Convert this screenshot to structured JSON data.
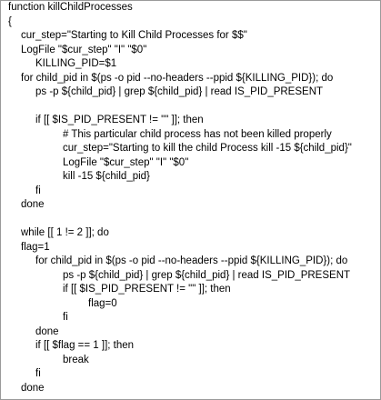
{
  "code": {
    "lines": [
      {
        "indent": 0,
        "text": "function killChildProcesses"
      },
      {
        "indent": 0,
        "text": "{"
      },
      {
        "indent": 1,
        "text": "cur_step=\"Starting to Kill Child Processes for $$\""
      },
      {
        "indent": 1,
        "text": "LogFile \"$cur_step\" \"I\" \"$0\""
      },
      {
        "indent": 2,
        "text": "KILLING_PID=$1"
      },
      {
        "indent": 1,
        "text": "for child_pid in $(ps -o pid --no-headers --ppid ${KILLING_PID}); do"
      },
      {
        "indent": 2,
        "text": "ps -p ${child_pid} | grep ${child_pid} | read IS_PID_PRESENT"
      },
      {
        "indent": 0,
        "text": ""
      },
      {
        "indent": 2,
        "text": "if [[ $IS_PID_PRESENT != \"\" ]]; then"
      },
      {
        "indent": 3,
        "text": "# This particular child process has not been killed properly"
      },
      {
        "indent": 3,
        "text": "cur_step=\"Starting to kill the child Process kill -15 ${child_pid}\""
      },
      {
        "indent": 3,
        "text": "LogFile \"$cur_step\" \"I\" \"$0\""
      },
      {
        "indent": 3,
        "text": "kill -15 ${child_pid}"
      },
      {
        "indent": 2,
        "text": "fi"
      },
      {
        "indent": 1,
        "text": "done"
      },
      {
        "indent": 0,
        "text": ""
      },
      {
        "indent": 1,
        "text": "while [[ 1 != 2 ]]; do"
      },
      {
        "indent": 1,
        "text": "flag=1"
      },
      {
        "indent": 2,
        "text": "for child_pid in $(ps -o pid --no-headers --ppid ${KILLING_PID}); do"
      },
      {
        "indent": 3,
        "text": "ps -p ${child_pid} | grep ${child_pid} | read IS_PID_PRESENT"
      },
      {
        "indent": 3,
        "text": "if [[ $IS_PID_PRESENT != \"\" ]]; then"
      },
      {
        "indent": 4,
        "text": "flag=0"
      },
      {
        "indent": 3,
        "text": "fi"
      },
      {
        "indent": 2,
        "text": "done"
      },
      {
        "indent": 2,
        "text": "if [[ $flag == 1 ]]; then"
      },
      {
        "indent": 3,
        "text": "break"
      },
      {
        "indent": 2,
        "text": "fi"
      },
      {
        "indent": 1,
        "text": "done"
      }
    ]
  }
}
